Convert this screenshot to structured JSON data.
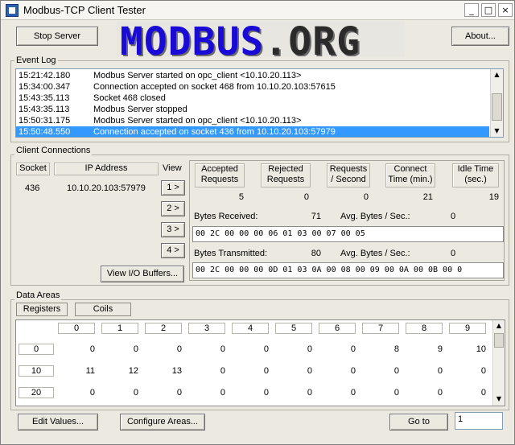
{
  "window": {
    "title": "Modbus-TCP Client Tester",
    "min": "_",
    "max": "□",
    "close": "×"
  },
  "toolbar": {
    "stop_server": "Stop Server",
    "about": "About..."
  },
  "logo": {
    "part1": "MODBUS",
    "part2": ".ORG"
  },
  "event_log": {
    "title": "Event Log",
    "rows": [
      {
        "time": "15:21:42.180",
        "msg": "Modbus Server started on opc_client <10.10.20.113>"
      },
      {
        "time": "15:34:00.347",
        "msg": "Connection accepted on socket 468 from 10.10.20.103:57615"
      },
      {
        "time": "15:43:35.113",
        "msg": "Socket 468 closed"
      },
      {
        "time": "15:43:35.113",
        "msg": "Modbus Server stopped"
      },
      {
        "time": "15:50:31.175",
        "msg": "Modbus Server started on opc_client <10.10.20.113>"
      },
      {
        "time": "15:50:48.550",
        "msg": "Connection accepted on socket 436 from 10.10.20.103:57979"
      }
    ]
  },
  "clients": {
    "title": "Client Connections",
    "headers": {
      "socket": "Socket",
      "ip": "IP Address",
      "view": "View"
    },
    "row": {
      "socket": "436",
      "ip": "10.10.20.103:57979"
    },
    "view_buttons": [
      "1 >",
      "2 >",
      "3 >",
      "4 >"
    ],
    "view_io": "View I/O Buffers...",
    "stats_headers": [
      "Accepted\nRequests",
      "Rejected\nRequests",
      "Requests\n/ Second",
      "Connect\nTime (min.)",
      "Idle Time\n(sec.)"
    ],
    "stats_values": [
      "5",
      "0",
      "0",
      "21",
      "19"
    ],
    "bytes_received_label": "Bytes Received:",
    "bytes_received": "71",
    "avg_rx_label": "Avg. Bytes / Sec.:",
    "avg_rx": "0",
    "rx_hex": "00 2C 00 00 00 06 01 03 00 07 00 05",
    "bytes_transmitted_label": "Bytes Transmitted:",
    "bytes_transmitted": "80",
    "avg_tx_label": "Avg. Bytes / Sec.:",
    "avg_tx": "0",
    "tx_hex": "00 2C 00 00 00 0D 01 03 0A 00 08 00 09 00 0A 00 0B 00 0"
  },
  "data_areas": {
    "title": "Data Areas",
    "tabs": [
      "Registers",
      "Coils"
    ],
    "col_headers": [
      "0",
      "1",
      "2",
      "3",
      "4",
      "5",
      "6",
      "7",
      "8",
      "9"
    ],
    "rows": [
      {
        "label": "0",
        "values": [
          "0",
          "0",
          "0",
          "0",
          "0",
          "0",
          "0",
          "8",
          "9",
          "10"
        ]
      },
      {
        "label": "10",
        "values": [
          "11",
          "12",
          "13",
          "0",
          "0",
          "0",
          "0",
          "0",
          "0",
          "0"
        ]
      },
      {
        "label": "20",
        "values": [
          "0",
          "0",
          "0",
          "0",
          "0",
          "0",
          "0",
          "0",
          "0",
          "0"
        ]
      }
    ]
  },
  "footer": {
    "edit_values": "Edit Values...",
    "configure_areas": "Configure Areas...",
    "goto": "Go to",
    "goto_value": "1"
  }
}
